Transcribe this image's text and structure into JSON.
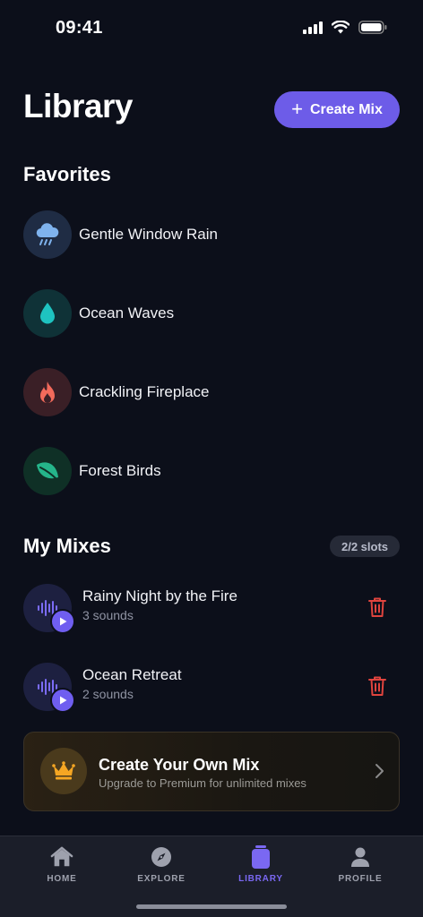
{
  "status_bar": {
    "time": "09:41"
  },
  "header": {
    "title": "Library",
    "create_button_label": "Create Mix"
  },
  "favorites": {
    "title": "Favorites",
    "items": [
      {
        "label": "Gentle Window Rain",
        "icon": "rain-cloud-icon"
      },
      {
        "label": "Ocean Waves",
        "icon": "water-drop-icon"
      },
      {
        "label": "Crackling Fireplace",
        "icon": "fire-icon"
      },
      {
        "label": "Forest Birds",
        "icon": "leaf-icon"
      }
    ]
  },
  "my_mixes": {
    "title": "My Mixes",
    "slots": "2/2 slots",
    "items": [
      {
        "name": "Rainy Night by the Fire",
        "count": "3 sounds"
      },
      {
        "name": "Ocean Retreat",
        "count": "2 sounds"
      }
    ]
  },
  "premium": {
    "title": "Create Your Own Mix",
    "subtitle": "Upgrade to Premium for unlimited mixes"
  },
  "tabs": [
    {
      "label": "HOME",
      "icon": "home-icon"
    },
    {
      "label": "EXPLORE",
      "icon": "compass-icon"
    },
    {
      "label": "LIBRARY",
      "icon": "library-icon",
      "active": true
    },
    {
      "label": "PROFILE",
      "icon": "person-icon"
    }
  ],
  "colors": {
    "background": "#0c0f1a",
    "accent": "#6d5ce8",
    "delete": "#e0443e",
    "premium_gold": "#f5a623"
  }
}
